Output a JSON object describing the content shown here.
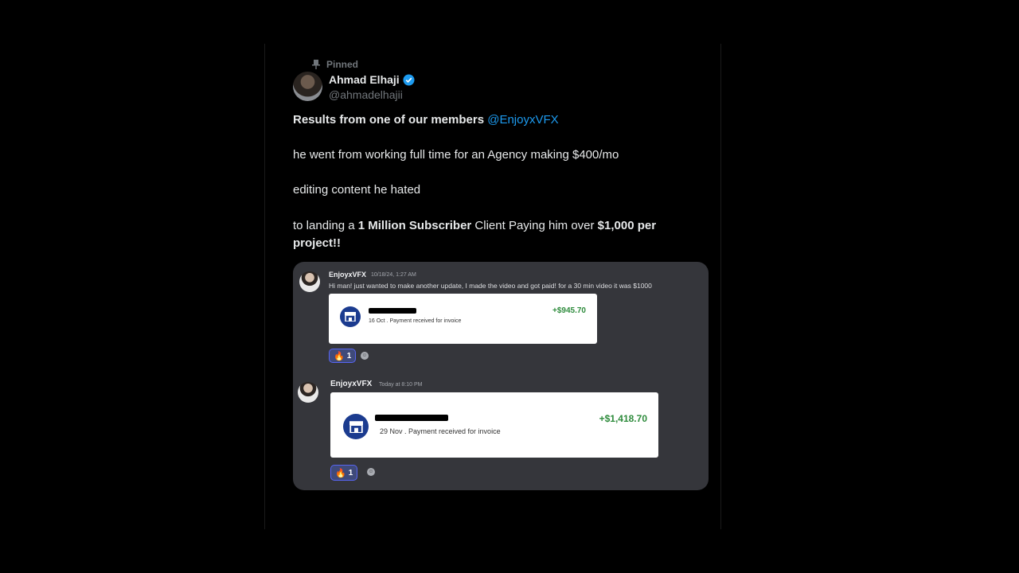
{
  "post": {
    "pinned_label": "Pinned",
    "author_name": "Ahmad Elhaji",
    "author_handle": "@ahmadelhajii",
    "lines": {
      "line1_bold": "Results from one of our members",
      "line1_mention": "@EnjoyxVFX",
      "line2": "he went from working full time for an Agency making $400/mo",
      "line3": "editing content he hated",
      "line4_a": "to landing a ",
      "line4_b": "1 Million Subscriber",
      "line4_c": " Client Paying him over ",
      "line4_d": "$1,000 per project!!"
    },
    "colors": {
      "mention": "#1d9bf0",
      "verified": "#1d9bf0",
      "amount": "#2e8b3c",
      "store_icon_bg": "#1b3b8f"
    }
  },
  "media": {
    "messages": [
      {
        "user": "EnjoyxVFX",
        "time": "10/18/24, 1:27 AM",
        "text": "Hi man! just wanted to make another update, I made the video and got paid! for a 30 min video it was $1000",
        "payment": {
          "desc": "16 Oct . Payment received for invoice",
          "amount": "+$945.70"
        },
        "reaction_count": "1"
      },
      {
        "user": "EnjoyxVFX",
        "time": "Today at 8:10 PM",
        "text": "",
        "payment": {
          "desc": "29 Nov . Payment received for invoice",
          "amount": "+$1,418.70"
        },
        "reaction_count": "1"
      }
    ],
    "icons": [
      "store-icon",
      "fire-emoji-icon",
      "add-reaction-icon"
    ]
  }
}
